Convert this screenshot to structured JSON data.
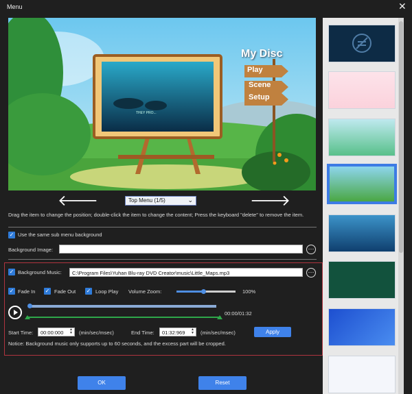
{
  "window": {
    "title": "Menu",
    "close_icon": "close-icon"
  },
  "preview": {
    "menu_title": "My Disc",
    "buttons": [
      "Play",
      "Scene",
      "Setup"
    ],
    "screen_caption": "THEY PRO..."
  },
  "nav": {
    "select_value": "Top Menu (1/5)",
    "prev_icon": "arrow-left-icon",
    "next_icon": "arrow-right-icon"
  },
  "hint": "Drag the item to change the position; double-click the item to change the content; Press the keyboard \"delete\" to remove the item.",
  "same_sub_menu": {
    "label": "Use the same sub menu background",
    "checked": true
  },
  "background_image": {
    "label": "Background Image:",
    "value": ""
  },
  "background_music": {
    "label": "Background Music:",
    "checked": true,
    "value": "C:\\Program Files\\Yuhan Blu-ray DVD Creator\\music\\Little_Maps.mp3"
  },
  "options": {
    "fade_in": "Fade In",
    "fade_out": "Fade Out",
    "loop_play": "Loop Play",
    "volume_label": "Volume Zoom:",
    "volume_value": "100%",
    "volume_level": 0.45
  },
  "player": {
    "time": "00:00/01:32",
    "progress": 0.0
  },
  "trim": {
    "start_label": "Start Time:",
    "start_value": "00:00:000",
    "end_label": "End Time:",
    "end_value": "01:32:969",
    "unit": "(min/sec/msec)",
    "apply": "Apply"
  },
  "notice": "Notice: Background music only supports up to 60 seconds, and the excess part will be cropped.",
  "footer": {
    "ok": "OK",
    "reset": "Reset"
  },
  "colors": {
    "accent": "#3f82ea",
    "frame": "#b0343f"
  }
}
